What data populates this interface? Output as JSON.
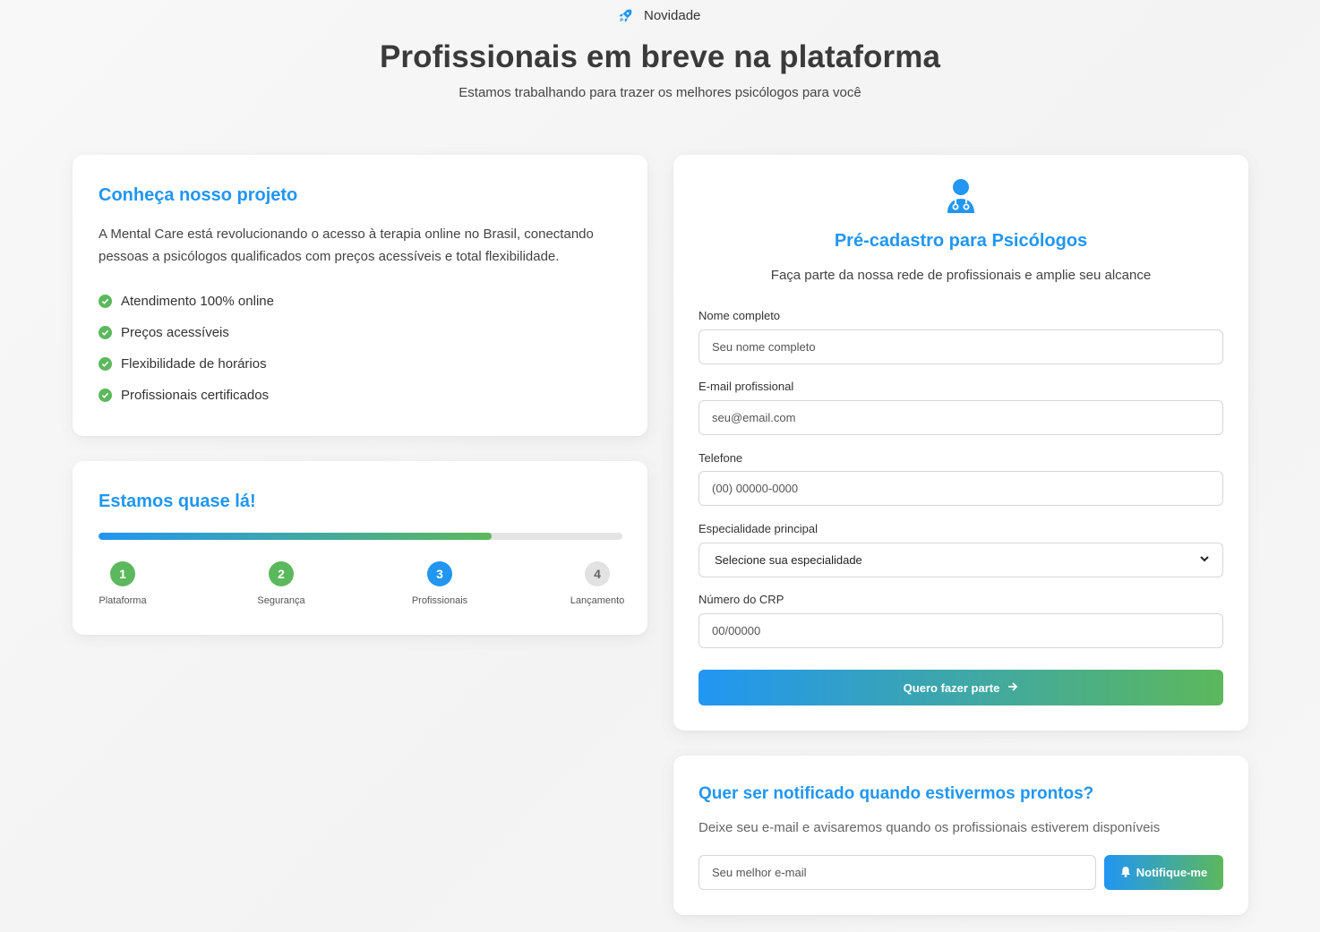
{
  "header": {
    "badge_icon": "rocket-icon",
    "badge_label": "Novidade",
    "title": "Profissionais em breve na plataforma",
    "subtitle": "Estamos trabalhando para trazer os melhores psicólogos para você"
  },
  "colors": {
    "primary": "#2196f3",
    "success": "#5cb85c",
    "pending": "#e2e2e2"
  },
  "project": {
    "title": "Conheça nosso projeto",
    "description": "A Mental Care está revolucionando o acesso à terapia online no Brasil, conectando pessoas a psicólogos qualificados com preços acessíveis e total flexibilidade.",
    "features": [
      "Atendimento 100% online",
      "Preços acessíveis",
      "Flexibilidade de horários",
      "Profissionais certificados"
    ]
  },
  "progress": {
    "title": "Estamos quase lá!",
    "percent": 75,
    "steps": [
      {
        "number": "1",
        "label": "Plataforma",
        "status": "done"
      },
      {
        "number": "2",
        "label": "Segurança",
        "status": "done"
      },
      {
        "number": "3",
        "label": "Profissionais",
        "status": "active"
      },
      {
        "number": "4",
        "label": "Lançamento",
        "status": "pending"
      }
    ]
  },
  "register": {
    "icon": "doctor-icon",
    "title": "Pré-cadastro para Psicólogos",
    "intro": "Faça parte da nossa rede de profissionais e amplie seu alcance",
    "fields": {
      "name": {
        "label": "Nome completo",
        "placeholder": "Seu nome completo"
      },
      "email": {
        "label": "E-mail profissional",
        "placeholder": "seu@email.com"
      },
      "phone": {
        "label": "Telefone",
        "placeholder": "(00) 00000-0000"
      },
      "specialty": {
        "label": "Especialidade principal",
        "value": "Selecione sua especialidade"
      },
      "crp": {
        "label": "Número do CRP",
        "placeholder": "00/00000"
      }
    },
    "submit_label": "Quero fazer parte"
  },
  "notify": {
    "title": "Quer ser notificado quando estivermos prontos?",
    "description": "Deixe seu e-mail e avisaremos quando os profissionais estiverem disponíveis",
    "placeholder": "Seu melhor e-mail",
    "button_label": "Notifique-me"
  }
}
